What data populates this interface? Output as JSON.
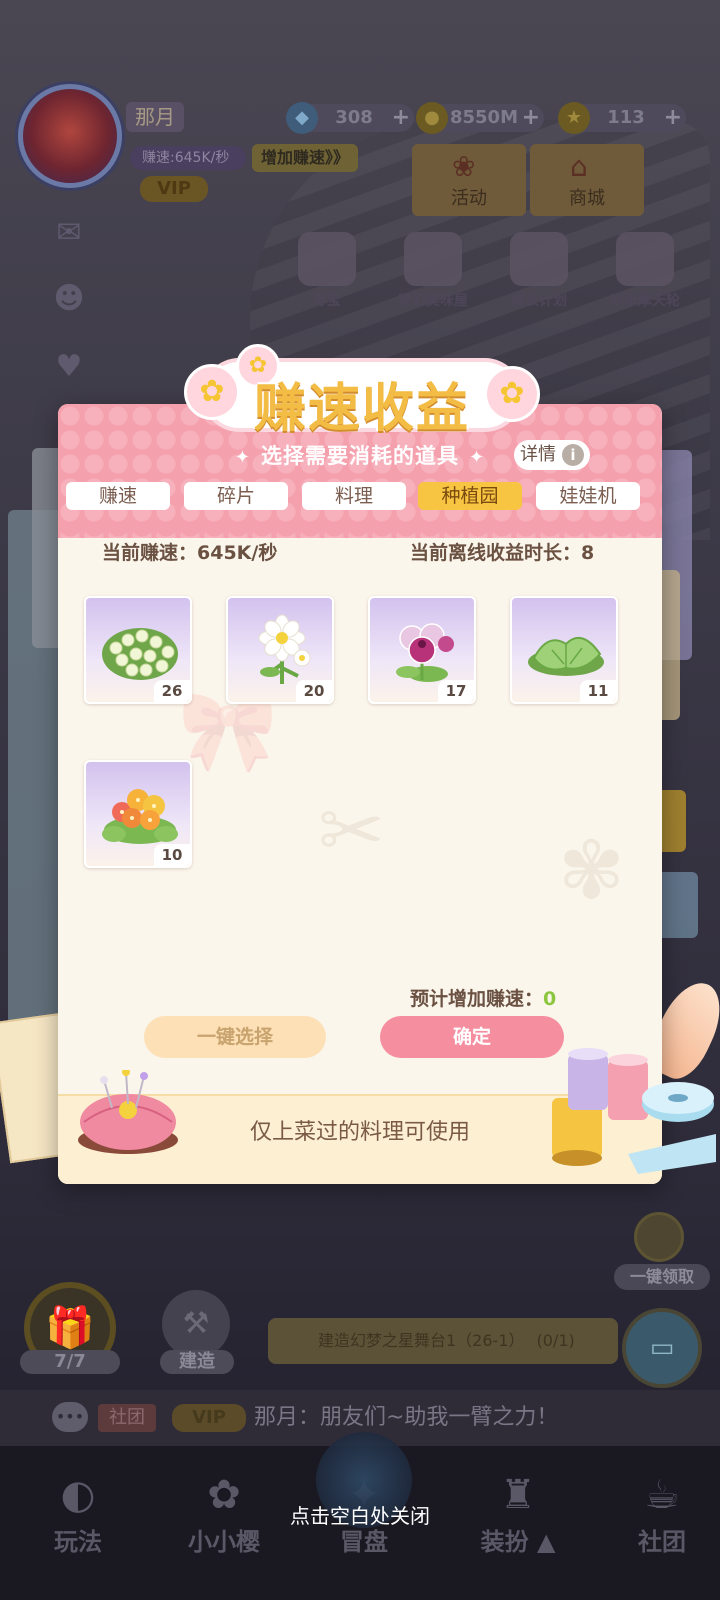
{
  "player": {
    "name": "那月",
    "earn_rate": "赚速:645K/秒",
    "boost_label": "增加赚速》》",
    "vip": "VIP"
  },
  "currencies": [
    {
      "icon": "gem-icon",
      "value": "308"
    },
    {
      "icon": "coin-icon",
      "value": "8550M"
    },
    {
      "icon": "star-icon",
      "value": "113"
    }
  ],
  "top_tabs": [
    {
      "label": "活动",
      "icon": "event-icon"
    },
    {
      "label": "商城",
      "icon": "shop-icon"
    }
  ],
  "event_icons": [
    {
      "label": "寻宝"
    },
    {
      "label": "梦幻美味屋"
    },
    {
      "label": "成长计划"
    },
    {
      "label": "欢乐摩天轮"
    }
  ],
  "dialog": {
    "title": "赚速收益",
    "subtitle": "选择需要消耗的道具",
    "detail_label": "详情",
    "tabs": [
      {
        "label": "赚速",
        "active": false
      },
      {
        "label": "碎片",
        "active": false
      },
      {
        "label": "料理",
        "active": false
      },
      {
        "label": "种植园",
        "active": true
      },
      {
        "label": "娃娃机",
        "active": false
      }
    ],
    "current_speed": "当前赚速：645K/秒",
    "offline_duration": "当前离线收益时长：8",
    "items": [
      {
        "name": "white-flower-bush",
        "count": "26",
        "color": "#e8f0c8"
      },
      {
        "name": "daisy",
        "count": "20",
        "color": "#ffffff"
      },
      {
        "name": "pansy",
        "count": "17",
        "color": "#b8327a"
      },
      {
        "name": "lettuce",
        "count": "11",
        "color": "#8ec56a"
      },
      {
        "name": "orange-flower-bush",
        "count": "10",
        "color": "#f7a23a"
      }
    ],
    "estimate_label": "预计增加赚速：",
    "estimate_value": "0",
    "select_all_label": "一键选择",
    "confirm_label": "确定",
    "footer_note": "仅上菜过的料理可使用"
  },
  "lower": {
    "gift_count": "7/7",
    "build_label": "建造",
    "collect_label": "一键领取",
    "quest_text": "建造幻梦之星舞台1（26-1）",
    "quest_progress": "(0/1)"
  },
  "chat": {
    "tag": "社团",
    "vip": "VIP",
    "message": "那月：朋友们~助我一臂之力！"
  },
  "nav": [
    {
      "label": "玩法",
      "icon": "gameplay-icon"
    },
    {
      "label": "小小樱",
      "icon": "sakura-icon"
    },
    {
      "label": "冒盘",
      "icon": "center-icon"
    },
    {
      "label": "装扮",
      "icon": "dressup-icon"
    },
    {
      "label": "社团",
      "icon": "club-icon"
    }
  ],
  "close_hint": "点击空白处关闭"
}
